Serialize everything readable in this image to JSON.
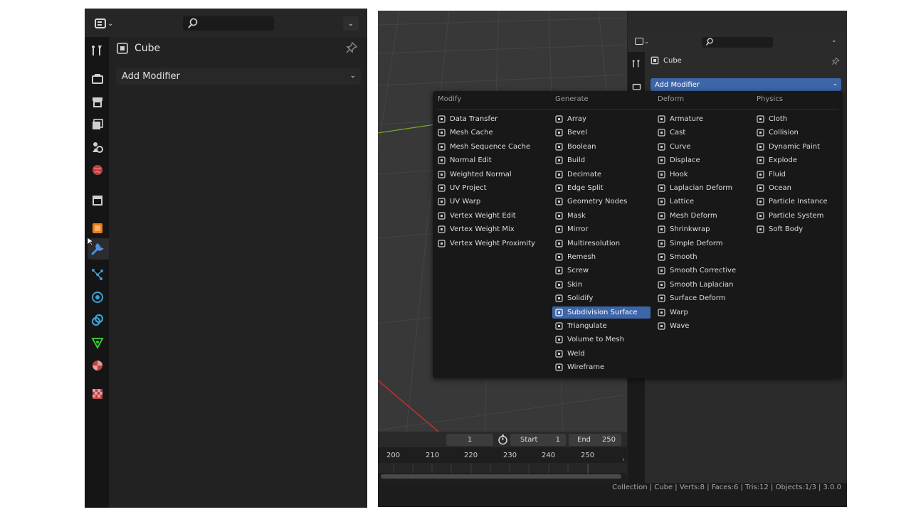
{
  "left_panel": {
    "object_name": "Cube",
    "add_modifier_label": "Add Modifier"
  },
  "right_panel": {
    "object_name": "Cube",
    "add_modifier_label": "Add Modifier"
  },
  "menu": {
    "columns": [
      {
        "header": "Modify",
        "items": [
          "Data Transfer",
          "Mesh Cache",
          "Mesh Sequence Cache",
          "Normal Edit",
          "Weighted Normal",
          "UV Project",
          "UV Warp",
          "Vertex Weight Edit",
          "Vertex Weight Mix",
          "Vertex Weight Proximity"
        ]
      },
      {
        "header": "Generate",
        "items": [
          "Array",
          "Bevel",
          "Boolean",
          "Build",
          "Decimate",
          "Edge Split",
          "Geometry Nodes",
          "Mask",
          "Mirror",
          "Multiresolution",
          "Remesh",
          "Screw",
          "Skin",
          "Solidify",
          "Subdivision Surface",
          "Triangulate",
          "Volume to Mesh",
          "Weld",
          "Wireframe"
        ]
      },
      {
        "header": "Deform",
        "items": [
          "Armature",
          "Cast",
          "Curve",
          "Displace",
          "Hook",
          "Laplacian Deform",
          "Lattice",
          "Mesh Deform",
          "Shrinkwrap",
          "Simple Deform",
          "Smooth",
          "Smooth Corrective",
          "Smooth Laplacian",
          "Surface Deform",
          "Warp",
          "Wave"
        ]
      },
      {
        "header": "Physics",
        "items": [
          "Cloth",
          "Collision",
          "Dynamic Paint",
          "Explode",
          "Fluid",
          "Ocean",
          "Particle Instance",
          "Particle System",
          "Soft Body"
        ]
      }
    ],
    "selected_item": "Subdivision Surface"
  },
  "timeline": {
    "current_frame": "1",
    "start_label": "Start",
    "start_value": "1",
    "end_label": "End",
    "end_value": "250",
    "ruler": [
      "200",
      "210",
      "220",
      "230",
      "240",
      "250"
    ]
  },
  "status_bar": {
    "text": "Collection | Cube | Verts:8 | Faces:6 | Tris:12 | Objects:1/3 | 3.0.0"
  },
  "colors": {
    "accent": "#3d66a8",
    "panel_bg": "#222222",
    "menu_bg": "#181818"
  },
  "icons": {
    "left_tabs": [
      "tool-icon",
      "render-icon",
      "output-icon",
      "view-layer-icon",
      "scene-icon",
      "world-icon",
      "collection-icon",
      "object-icon",
      "modifier-icon",
      "particles-icon",
      "physics-icon",
      "constraints-icon",
      "data-icon",
      "material-icon",
      "texture-icon"
    ]
  }
}
